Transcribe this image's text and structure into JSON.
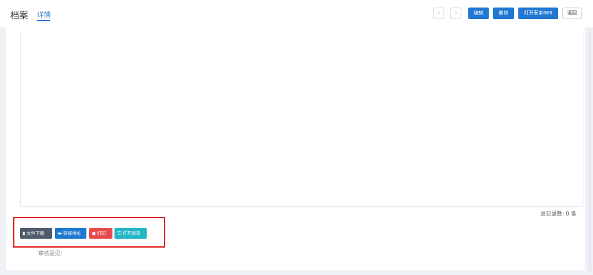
{
  "header": {
    "title": "档案",
    "active_tab": "详情",
    "prev_icon": "chevron-left-icon",
    "next_icon": "chevron-right-icon",
    "prev_glyph": "‹",
    "next_glyph": "›",
    "buttons": {
      "edit": "编辑",
      "delete": "删除",
      "open_form": "打开表单666",
      "back": "返回"
    }
  },
  "main": {
    "total_records": "总记录数: 0 条",
    "actions": {
      "download": {
        "label": "文件下载",
        "icon": "file-icon",
        "glyph": "▮",
        "color": "#4f5b6b"
      },
      "link": {
        "label": "链接地址",
        "icon": "envelope-icon",
        "glyph": "▬",
        "color": "#1f78d1"
      },
      "print": {
        "label": "打印",
        "icon": "print-icon",
        "glyph": "●",
        "color": "#e84b4b"
      },
      "open_form": {
        "label": "打开表单",
        "icon": "list-icon",
        "glyph": "☰",
        "color": "#23b7c6"
      }
    },
    "review_label": "审核意见:"
  },
  "colors": {
    "primary": "#1f78d1",
    "highlight_border": "#e02424",
    "tab_active": "#2f78d6"
  }
}
